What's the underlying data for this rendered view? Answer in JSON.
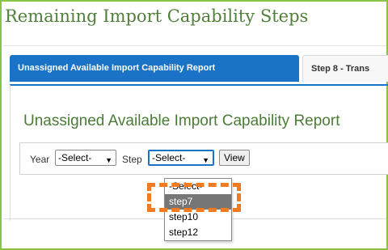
{
  "page": {
    "title": "Remaining Import Capability Steps"
  },
  "tabs": [
    {
      "label": "Unassigned Available Import Capability Report",
      "active": true
    },
    {
      "label": "Step 8 - Trans",
      "active": false
    }
  ],
  "report": {
    "title": "Unassigned Available Import Capability Report",
    "year_label": "Year",
    "year_value": "-Select-",
    "step_label": "Step",
    "step_value": "-Select-",
    "view_button": "View"
  },
  "step_dropdown": {
    "options": [
      "-Select-",
      "step7",
      "step10",
      "step12"
    ],
    "highlighted": "step7"
  },
  "colors": {
    "accent_blue": "#1a73c6",
    "title_green": "#4a7c36",
    "frame_green": "#8bc34a",
    "annotation_orange": "#f47a20"
  }
}
